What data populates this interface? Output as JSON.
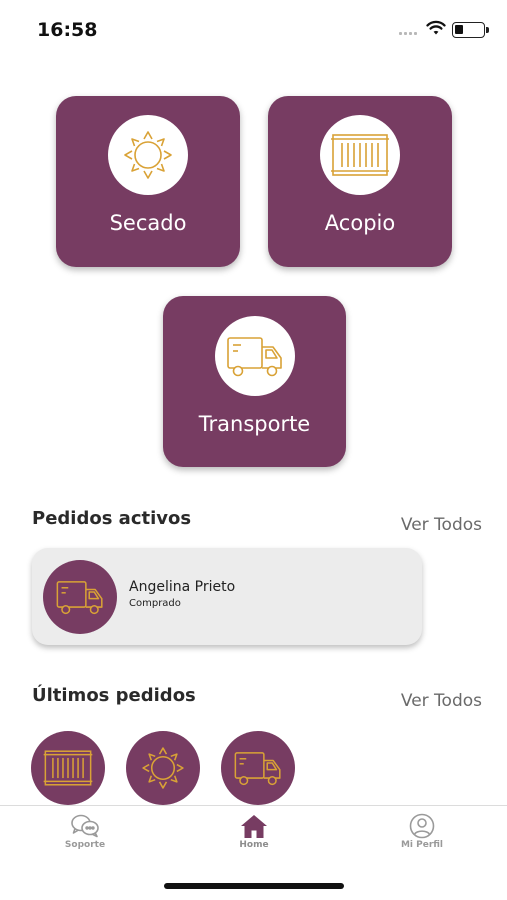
{
  "status_bar": {
    "time": "16:58",
    "icons": [
      "signal-icon",
      "wifi-icon",
      "battery-icon"
    ]
  },
  "colors": {
    "brand": "#773c62",
    "icon_gold": "#d9a236",
    "card_bg": "#ececec"
  },
  "services": [
    {
      "label": "Secado",
      "icon": "sun-icon"
    },
    {
      "label": "Acopio",
      "icon": "container-icon"
    },
    {
      "label": "Transporte",
      "icon": "truck-icon"
    }
  ],
  "active_orders": {
    "title": "Pedidos activos",
    "see_all": "Ver Todos",
    "items": [
      {
        "name": "Angelina Prieto",
        "status": "Comprado",
        "icon": "truck-icon"
      }
    ]
  },
  "recent_orders": {
    "title": "Últimos pedidos",
    "see_all": "Ver Todos",
    "items": [
      {
        "icon": "container-icon"
      },
      {
        "icon": "sun-icon"
      },
      {
        "icon": "truck-icon"
      }
    ]
  },
  "tab_bar": {
    "items": [
      {
        "label": "Soporte",
        "icon": "chat-bubbles-icon"
      },
      {
        "label": "Home",
        "icon": "home-icon",
        "active": true
      },
      {
        "label": "Mi Perfil",
        "icon": "user-circle-icon"
      }
    ]
  }
}
